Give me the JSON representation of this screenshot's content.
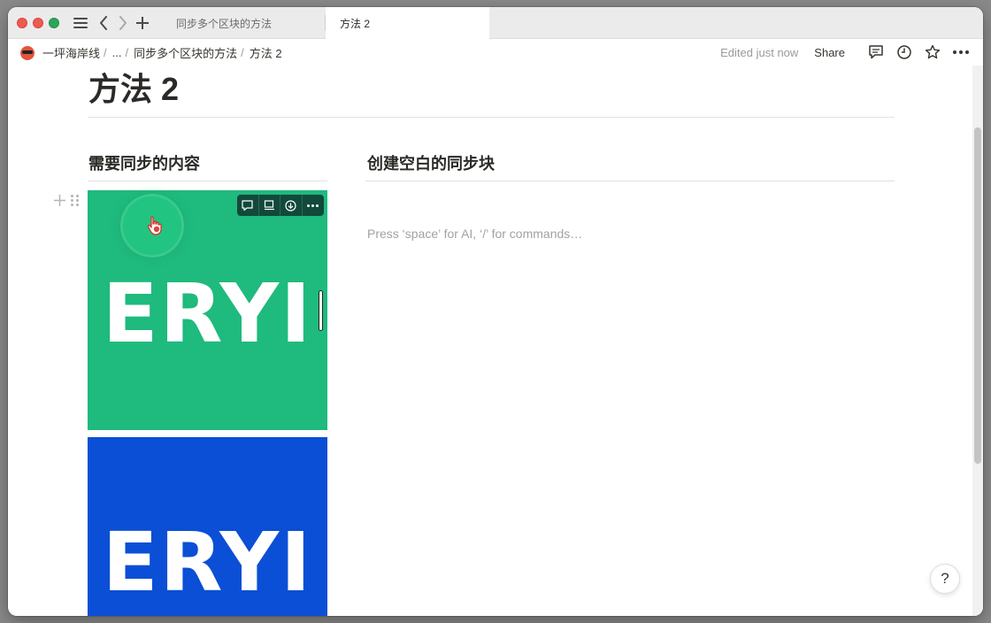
{
  "window": {
    "tabs": [
      {
        "label": "同步多个区块的方法",
        "active": false
      },
      {
        "label": "方法 2",
        "active": true
      }
    ]
  },
  "topbar": {
    "breadcrumbs": [
      "一坪海岸线",
      "...",
      "同步多个区块的方法",
      "方法 2"
    ],
    "edited_text": "Edited just now",
    "share_label": "Share"
  },
  "page": {
    "title": "方法 2",
    "columns": [
      {
        "heading": "需要同步的内容"
      },
      {
        "heading": "创建空白的同步块"
      }
    ],
    "images": [
      {
        "text": "ERYI",
        "background": "#1fba7d"
      },
      {
        "text": "ERYI",
        "background": "#0b4fd6"
      }
    ],
    "placeholder": "Press ‘space’ for AI, ‘/’ for commands…"
  },
  "help_label": "?",
  "colors": {
    "accent_green": "#1fba7d",
    "accent_blue": "#0b4fd6",
    "image_toolbar": "#11493a"
  }
}
